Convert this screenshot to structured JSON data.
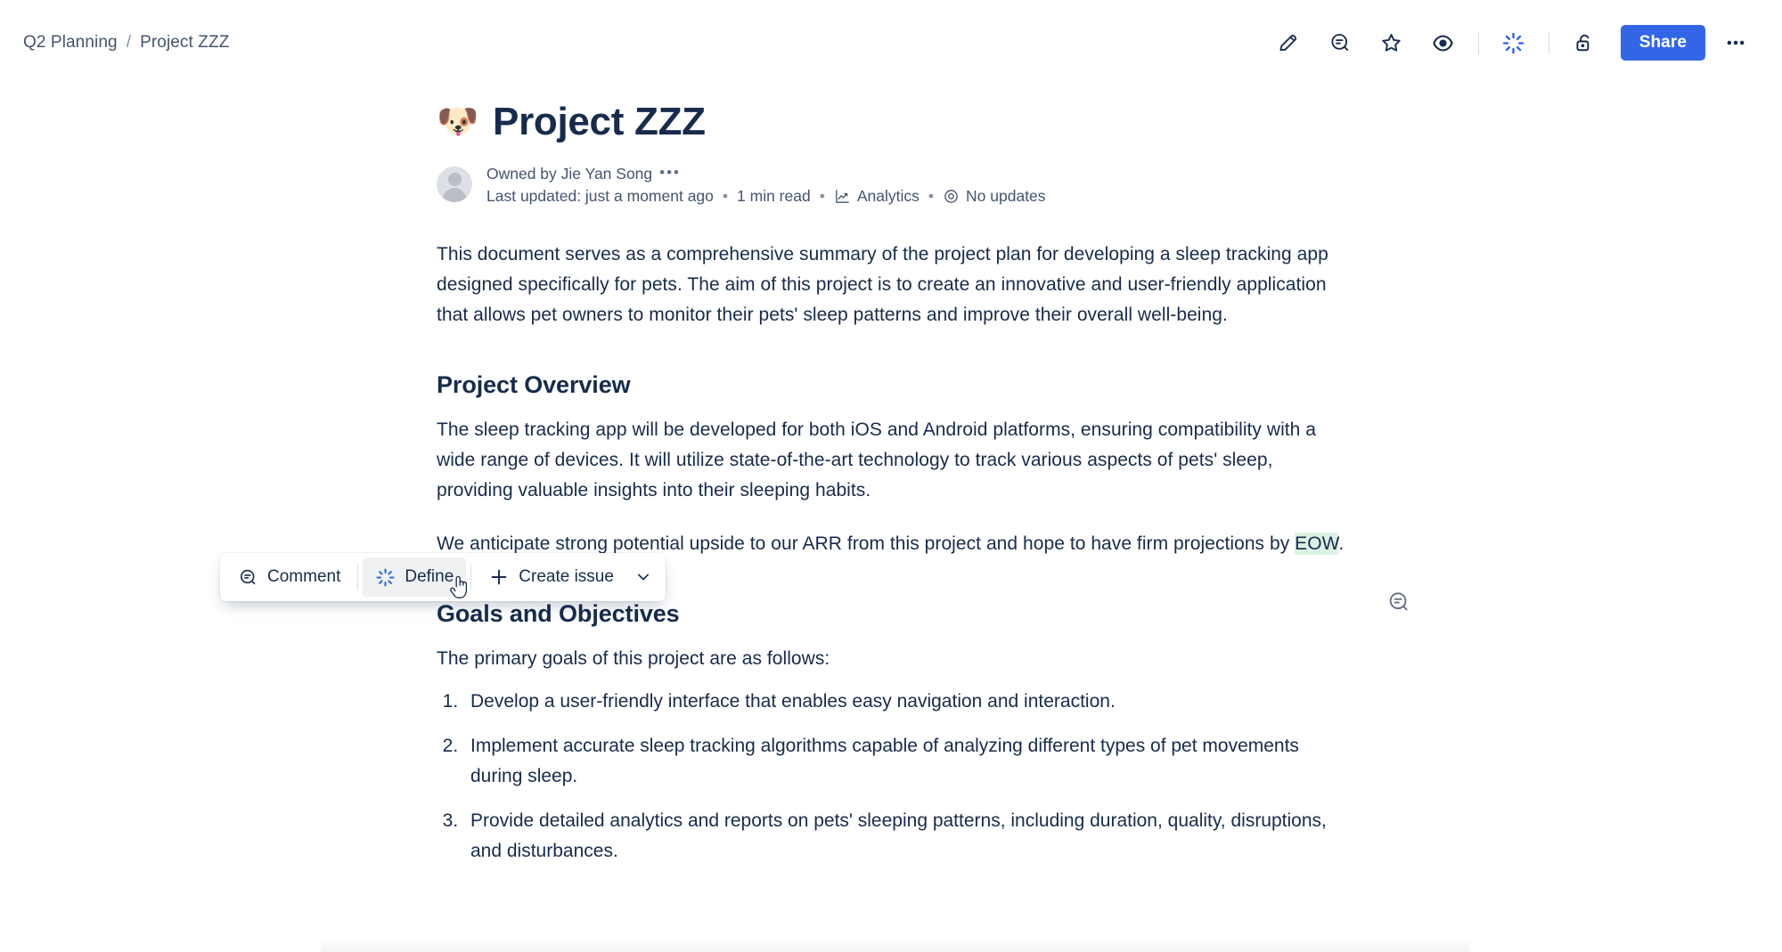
{
  "breadcrumb": {
    "items": [
      "Q2 Planning",
      "Project ZZZ"
    ],
    "separator": "/"
  },
  "topbar": {
    "icons": [
      {
        "name": "edit-pencil-icon",
        "label": "Edit"
      },
      {
        "name": "comment-icon",
        "label": "Comments"
      },
      {
        "name": "star-icon",
        "label": "Star"
      },
      {
        "name": "watch-eye-icon",
        "label": "Watch"
      },
      {
        "name": "ai-sparkle-icon",
        "label": "Atlassian Intelligence"
      },
      {
        "name": "unlock-icon",
        "label": "Restrictions"
      }
    ],
    "share_label": "Share",
    "more_label": "•••",
    "share_color": "#3366e6",
    "ai_icon_color": "#2563eb"
  },
  "document": {
    "emoji": "🐶",
    "title": "Project ZZZ",
    "meta": {
      "owner": "Owned by Jie Yan Song",
      "owner_more": "•••",
      "last_updated": "Last updated: just a moment ago",
      "read_time": "1 min read",
      "analytics": "Analytics",
      "updates": "No updates",
      "separator": "•"
    },
    "intro_paragraph": "This document serves as a comprehensive summary of the project plan for developing a sleep tracking app designed specifically for pets. The aim of this project is to create an innovative and user-friendly application that allows pet owners to monitor their pets' sleep patterns and improve their overall well-being.",
    "sections": [
      {
        "heading": "Project Overview",
        "paragraph": "The sleep tracking app will be developed for both iOS and Android platforms, ensuring compatibility with a wide range of devices. It will utilize state-of-the-art technology to track various aspects of pets' sleep, providing valuable insights into their sleeping habits."
      }
    ],
    "arr_paragraph": {
      "before": "We anticipate strong potential upside to our ARR from this project and hope to have firm projections by ",
      "highlight": "EOW",
      "after": ".",
      "highlight_color": "#dcf2e4"
    },
    "goals_section": {
      "heading": "Goals and Objectives",
      "lead": "The primary goals of this project are as follows:",
      "items": [
        "Develop a user-friendly interface that enables easy navigation and interaction.",
        "Implement accurate sleep tracking algorithms capable of analyzing different types of pet movements during sleep.",
        "Provide detailed analytics and reports on pets' sleeping patterns, including duration, quality, disruptions, and disturbances."
      ]
    }
  },
  "float_toolbar": {
    "comment_label": "Comment",
    "define_label": "Define",
    "create_issue_label": "Create issue",
    "chevron": "chevron-down-icon",
    "active_item": "Define"
  },
  "gutter": {
    "comment_icon": "comment-bubble-icon"
  }
}
